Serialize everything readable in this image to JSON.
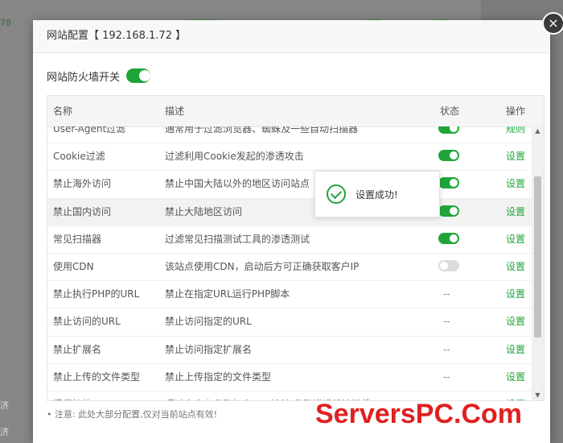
{
  "background": {
    "number_fragment": "78",
    "left_fragments": [
      "济",
      "济"
    ]
  },
  "dialog": {
    "title": "网站配置【 192.168.1.72 】",
    "close_icon": "close-icon",
    "firewall_label": "网站防火墙开关",
    "firewall_on": true,
    "columns": {
      "name": "名称",
      "desc": "描述",
      "status": "状态",
      "action": "操作"
    },
    "rows": [
      {
        "name": "User-Agent过滤",
        "desc": "通常用于过滤浏览器、蜘蛛及一些自动扫描器",
        "status": "on",
        "action": "规则"
      },
      {
        "name": "Cookie过滤",
        "desc": "过滤利用Cookie发起的渗透攻击",
        "status": "on",
        "action": "设置"
      },
      {
        "name": "禁止海外访问",
        "desc": "禁止中国大陆以外的地区访问站点",
        "status": "on",
        "action": "设置"
      },
      {
        "name": "禁止国内访问",
        "desc": "禁止大陆地区访问",
        "status": "on",
        "action": "设置"
      },
      {
        "name": "常见扫描器",
        "desc": "过滤常见扫描测试工具的渗透测试",
        "status": "on",
        "action": "设置"
      },
      {
        "name": "使用CDN",
        "desc": "该站点使用CDN，启动后方可正确获取客户IP",
        "status": "off",
        "action": "设置"
      },
      {
        "name": "禁止执行PHP的URL",
        "desc": "禁止在指定URL运行PHP脚本",
        "status": "--",
        "action": "设置"
      },
      {
        "name": "禁止访问的URL",
        "desc": "禁止访问指定的URL",
        "status": "--",
        "action": "设置"
      },
      {
        "name": "禁止扩展名",
        "desc": "禁止访问指定扩展名",
        "status": "--",
        "action": "设置"
      },
      {
        "name": "禁止上传的文件类型",
        "desc": "禁止上传指定的文件类型",
        "status": "--",
        "action": "设置"
      },
      {
        "name": "受保护的URL",
        "desc": "通过自定义参数加密URL地址,参数错误将被拦截",
        "status": "--",
        "action": "设置"
      }
    ],
    "highlighted_row": 3,
    "note": "• 注意: 此处大部分配置,仅对当前站点有效!"
  },
  "toast": {
    "text": "设置成功!",
    "icon": "check-circle-icon"
  },
  "watermark": "ServersPC.Com",
  "colors": {
    "accent": "#20a53a",
    "switch_off": "#dcdcdc"
  }
}
